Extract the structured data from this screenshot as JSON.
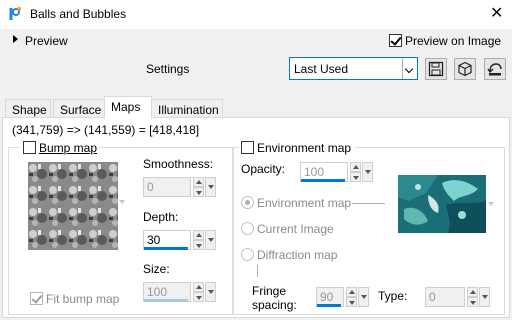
{
  "window": {
    "title": "Balls and Bubbles",
    "close_glyph": "✕"
  },
  "preview": {
    "label": "Preview",
    "preview_on_image_label": "Preview on Image",
    "preview_on_image_checked": true
  },
  "settings": {
    "label": "Settings",
    "preset_value": "Last Used"
  },
  "tabs": [
    {
      "label": "Shape",
      "active": false
    },
    {
      "label": "Surface",
      "active": false
    },
    {
      "label": "Maps",
      "active": true
    },
    {
      "label": "Illumination",
      "active": false
    }
  ],
  "coords_text": "(341,759) => (141,559) = [418,418]",
  "bump_map": {
    "label": "Bump map",
    "checked": false,
    "smoothness_label": "Smoothness:",
    "smoothness_value": "0",
    "depth_label": "Depth:",
    "depth_value": "30",
    "size_label": "Size:",
    "size_value": "100",
    "fit_label": "Fit bump map",
    "fit_checked": true
  },
  "environment_map": {
    "label": "Environment map",
    "checked": false,
    "opacity_label": "Opacity:",
    "opacity_value": "100",
    "radio_environment": "Environment map",
    "radio_current_image": "Current Image",
    "radio_diffraction": "Diffraction map",
    "fringe_label_line1": "Fringe",
    "fringe_label_line2": "spacing:",
    "fringe_value": "90",
    "type_label": "Type:",
    "type_value": "0"
  },
  "icons": {
    "app": "paint-shop-app-icon",
    "save": "save-preset-icon",
    "resource": "resource-manager-icon",
    "reset": "reset-icon"
  },
  "colors": {
    "accent": "#0078d7",
    "tab_panel_bg": "#ffffff",
    "window_bg": "#f0f0f0"
  }
}
